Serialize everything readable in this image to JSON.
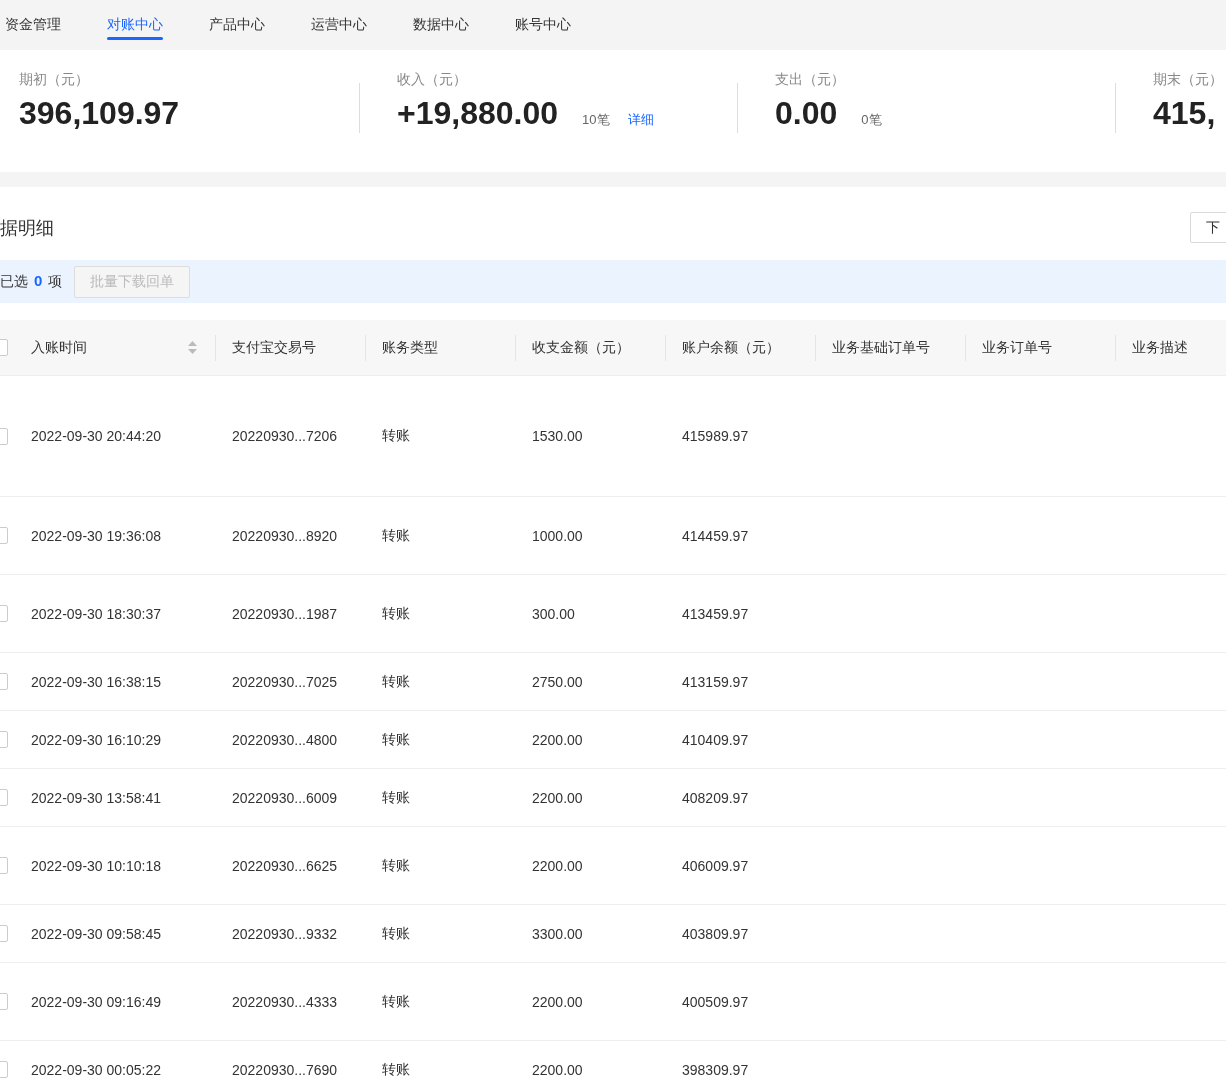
{
  "tabs": [
    {
      "label": "资金管理",
      "selected": false
    },
    {
      "label": "对账中心",
      "selected": true
    },
    {
      "label": "产品中心",
      "selected": false
    },
    {
      "label": "运营中心",
      "selected": false
    },
    {
      "label": "数据中心",
      "selected": false
    },
    {
      "label": "账号中心",
      "selected": false
    }
  ],
  "summary": [
    {
      "label": "期初（元）",
      "amount": "396,109.97"
    },
    {
      "label": "收入（元）",
      "amount": "+19,880.00",
      "count": "10笔",
      "link": "详细"
    },
    {
      "label": "支出（元）",
      "amount": "0.00",
      "count": "0笔"
    },
    {
      "label": "期末（元）",
      "amount": "415,"
    }
  ],
  "section": {
    "title": "据明细",
    "download_button": "下"
  },
  "selection": {
    "prefix": "已选",
    "count": "0",
    "suffix": "项",
    "batch_button": {
      "label": "批量下载回单",
      "disabled": true
    }
  },
  "table": {
    "header_checked": false,
    "columns": [
      {
        "label": "入账时间",
        "sortable": true
      },
      {
        "label": "支付宝交易号"
      },
      {
        "label": "账务类型"
      },
      {
        "label": "收支金额（元）"
      },
      {
        "label": "账户余额（元）"
      },
      {
        "label": "业务基础订单号"
      },
      {
        "label": "业务订单号"
      },
      {
        "label": "业务描述"
      }
    ],
    "rows": [
      {
        "checked": false,
        "cells": [
          "2022-09-30 20:44:20",
          "20220930...7206",
          "转账",
          "1530.00",
          "415989.97"
        ]
      },
      {
        "checked": false,
        "cells": [
          "2022-09-30 19:36:08",
          "20220930...8920",
          "转账",
          "1000.00",
          "414459.97"
        ]
      },
      {
        "checked": false,
        "cells": [
          "2022-09-30 18:30:37",
          "20220930...1987",
          "转账",
          "300.00",
          "413459.97"
        ]
      },
      {
        "checked": false,
        "cells": [
          "2022-09-30 16:38:15",
          "20220930...7025",
          "转账",
          "2750.00",
          "413159.97"
        ]
      },
      {
        "checked": false,
        "cells": [
          "2022-09-30 16:10:29",
          "20220930...4800",
          "转账",
          "2200.00",
          "410409.97"
        ]
      },
      {
        "checked": false,
        "cells": [
          "2022-09-30 13:58:41",
          "20220930...6009",
          "转账",
          "2200.00",
          "408209.97"
        ]
      },
      {
        "checked": false,
        "cells": [
          "2022-09-30 10:10:18",
          "20220930...6625",
          "转账",
          "2200.00",
          "406009.97"
        ]
      },
      {
        "checked": false,
        "cells": [
          "2022-09-30 09:58:45",
          "20220930...9332",
          "转账",
          "3300.00",
          "403809.97"
        ]
      },
      {
        "checked": false,
        "cells": [
          "2022-09-30 09:16:49",
          "20220930...4333",
          "转账",
          "2200.00",
          "400509.97"
        ]
      },
      {
        "checked": false,
        "cells": [
          "2022-09-30 00:05:22",
          "20220930...7690",
          "转账",
          "2200.00",
          "398309.97"
        ]
      }
    ]
  }
}
